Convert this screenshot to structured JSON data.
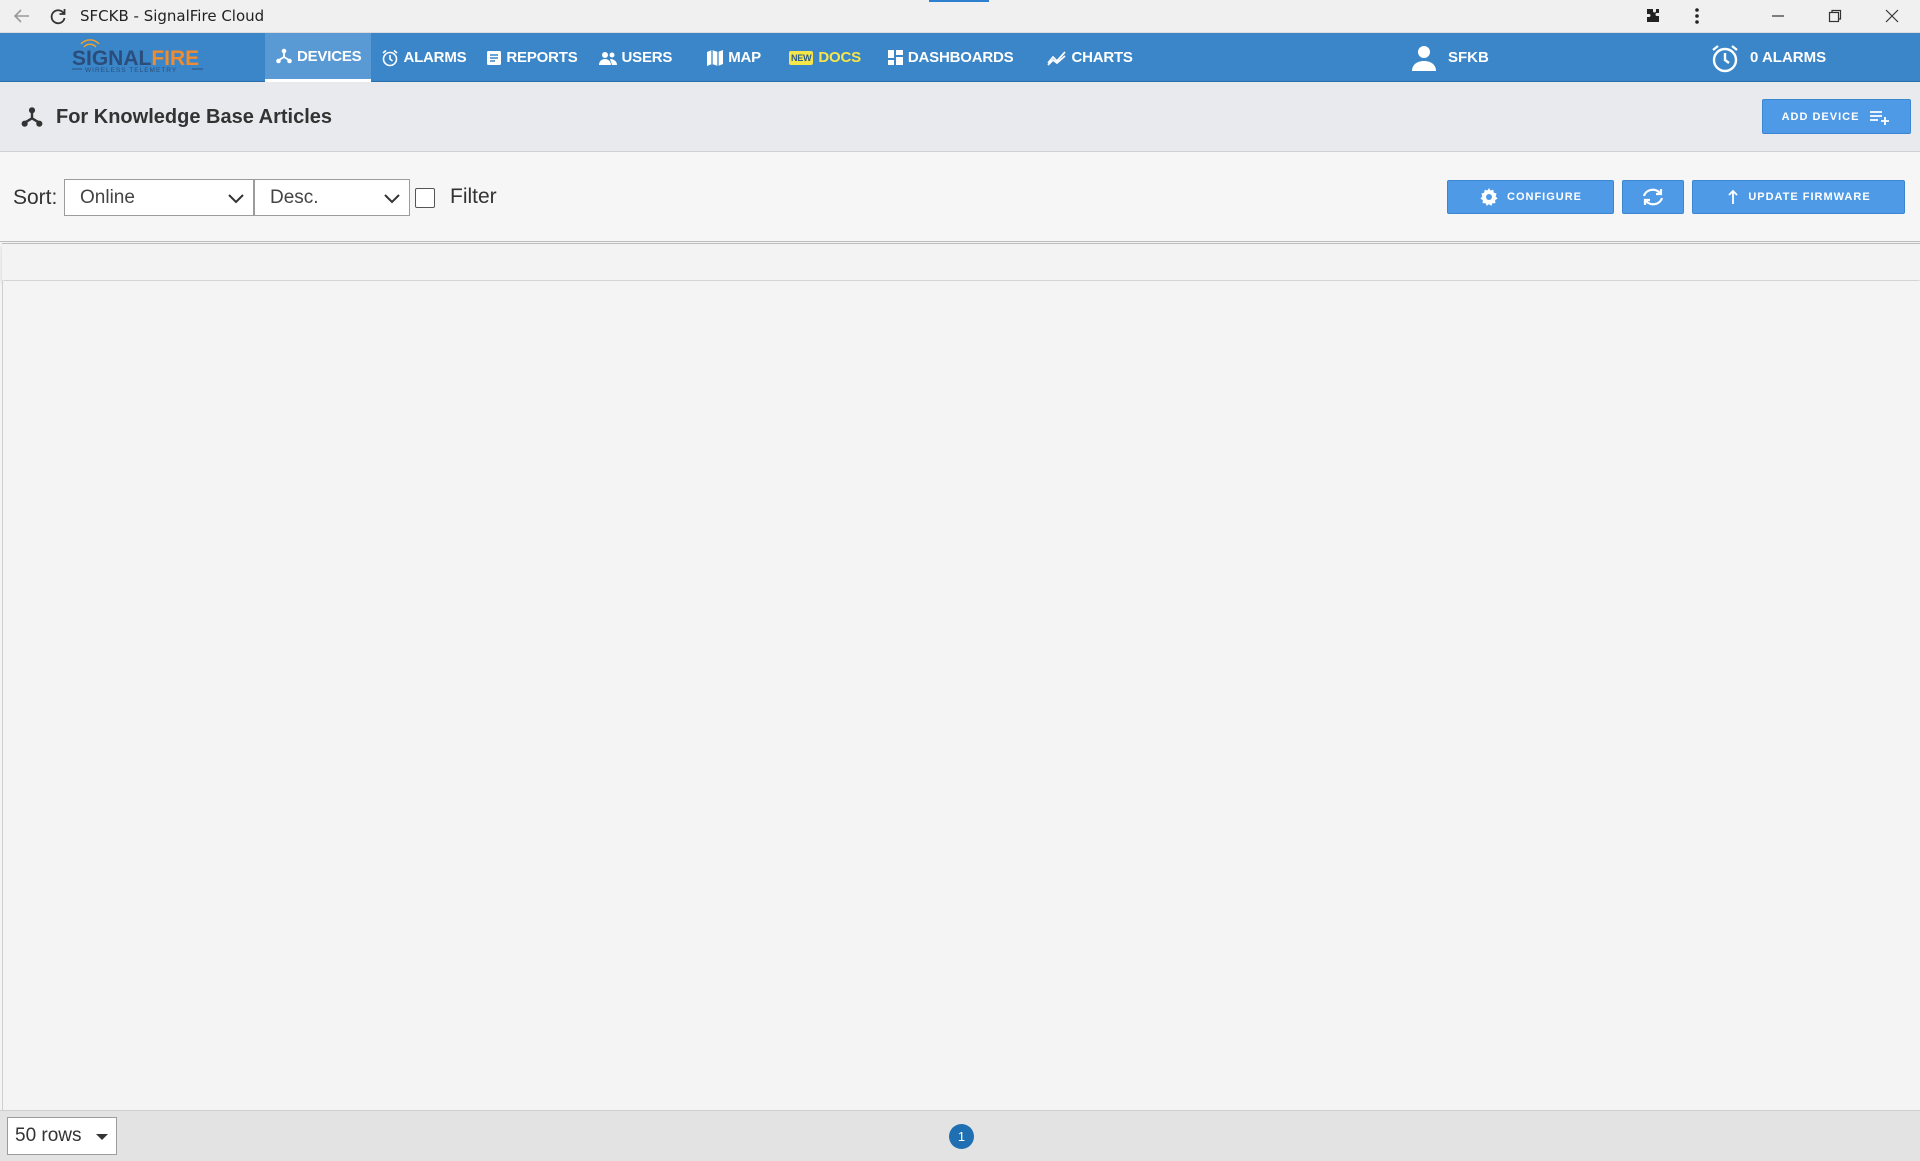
{
  "window": {
    "title": "SFCKB - SignalFire Cloud"
  },
  "brand": {
    "name": "SIGNALFIRE",
    "name_part1": "SIGNAL",
    "name_part2": "FIRE",
    "tagline": "WIRELESS TELEMETRY"
  },
  "nav": {
    "items": [
      {
        "label": "DEVICES",
        "icon": "devices-icon",
        "active": true
      },
      {
        "label": "ALARMS",
        "icon": "alarm-clock-icon"
      },
      {
        "label": "REPORTS",
        "icon": "report-icon"
      },
      {
        "label": "USERS",
        "icon": "users-icon"
      },
      {
        "label": "MAP",
        "icon": "map-icon"
      },
      {
        "label": "DOCS",
        "badge": "NEW",
        "icon": "new-badge"
      },
      {
        "label": "DASHBOARDS",
        "icon": "dashboard-icon"
      },
      {
        "label": "CHARTS",
        "icon": "chart-icon"
      }
    ],
    "user": "SFKB",
    "alarms": "0 ALARMS"
  },
  "page": {
    "title": "For Knowledge Base Articles",
    "add_device_label": "ADD DEVICE"
  },
  "toolbar": {
    "sort_label": "Sort:",
    "sort_value": "Online",
    "order_value": "Desc.",
    "filter_label": "Filter",
    "configure_label": "CONFIGURE",
    "update_firmware_label": "UPDATE FIRMWARE"
  },
  "footer": {
    "rows_value": "50 rows",
    "current_page": "1"
  },
  "colors": {
    "nav_bg": "#3a86c8",
    "button_bg": "#4f9ae6",
    "docs_yellow": "#f7e64a",
    "page_dot": "#1f6fb2"
  }
}
